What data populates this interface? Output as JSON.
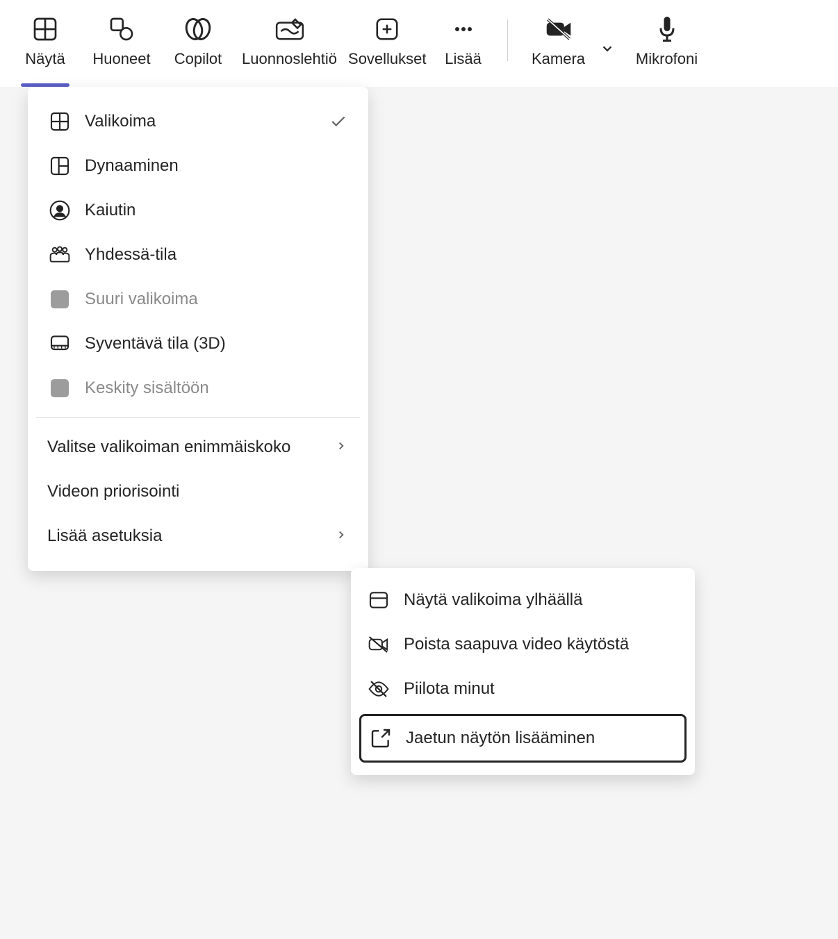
{
  "toolbar": {
    "view": "Näytä",
    "rooms": "Huoneet",
    "copilot": "Copilot",
    "whiteboard": "Luonnoslehtiö",
    "apps": "Sovellukset",
    "more": "Lisää",
    "camera": "Kamera",
    "microphone": "Mikrofoni"
  },
  "menu": {
    "gallery": "Valikoima",
    "dynamic": "Dynaaminen",
    "speaker": "Kaiutin",
    "together": "Yhdessä-tila",
    "large_gallery": "Suuri valikoima",
    "immersive_3d": "Syventävä tila (3D)",
    "focus_content": "Keskity sisältöön",
    "max_gallery_size": "Valitse valikoiman enimmäiskoko",
    "prioritize_video": "Videon priorisointi",
    "more_settings": "Lisää asetuksia"
  },
  "submenu": {
    "show_gallery_top": "Näytä valikoima ylhäällä",
    "disable_incoming_video": "Poista saapuva video käytöstä",
    "hide_me": "Piilota minut",
    "add_shared_screen": "Jaetun näytön lisääminen"
  }
}
